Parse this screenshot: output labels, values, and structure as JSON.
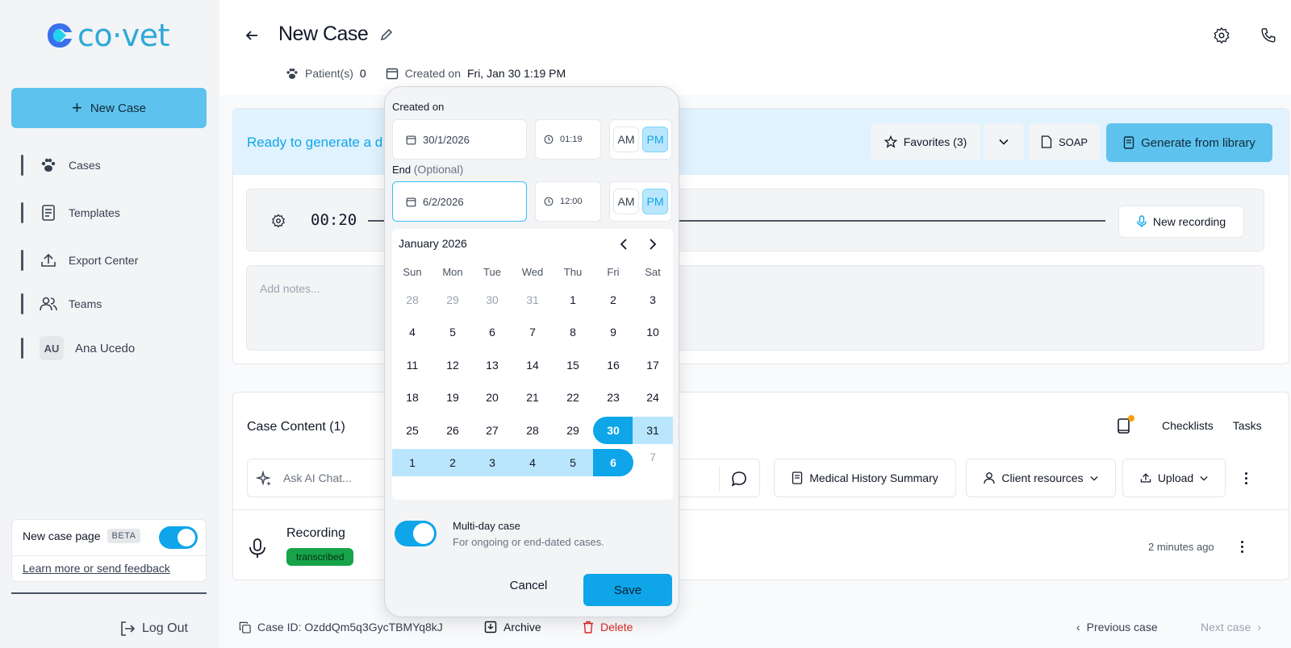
{
  "brand": {
    "name": "co·vet",
    "accent": "#2fa8d8"
  },
  "sidebar": {
    "new_case_label": "New Case",
    "items": [
      {
        "label": "Cases",
        "icon": "paw-icon"
      },
      {
        "label": "Templates",
        "icon": "document-icon"
      },
      {
        "label": "Export Center",
        "icon": "upload-icon"
      },
      {
        "label": "Teams",
        "icon": "users-icon"
      },
      {
        "label": "Ana Ucedo",
        "icon": "avatar",
        "initials": "AU"
      }
    ],
    "beta": {
      "label": "New case page",
      "badge": "BETA",
      "link": "Learn more or send feedback",
      "enabled": true
    },
    "logout_label": "Log Out"
  },
  "header": {
    "title": "New Case",
    "patients_label": "Patient(s)",
    "patients_count": "0",
    "created_label": "Created on",
    "created_value": "Fri, Jan 30 1:19 PM"
  },
  "banner": {
    "text": "Ready to generate a d",
    "favorites_label": "Favorites (3)",
    "soap_label": "SOAP",
    "generate_label": "Generate from library"
  },
  "recorder": {
    "timer": "00:20",
    "new_recording_label": "New recording",
    "notes_placeholder": "Add notes..."
  },
  "case_content": {
    "title": "Case Content (1)",
    "checklists_label": "Checklists",
    "tasks_label": "Tasks",
    "ask_placeholder": "Ask AI Chat...",
    "medical_history_label": "Medical History Summary",
    "client_resources_label": "Client resources",
    "upload_label": "Upload",
    "recording": {
      "title": "Recording",
      "status": "transcribed",
      "time": "2 minutes ago"
    }
  },
  "footer": {
    "case_id": "Case ID: OzddQm5q3GycTBMYq8kJ",
    "archive_label": "Archive",
    "delete_label": "Delete",
    "previous_label": "Previous case",
    "next_label": "Next case"
  },
  "picker": {
    "created_label": "Created on",
    "created_date": "30/1/2026",
    "created_time": "01:19",
    "end_label": "End",
    "end_optional": "(Optional)",
    "end_date": "6/2/2026",
    "end_time": "12:00",
    "am_label": "AM",
    "pm_label": "PM",
    "month_title": "January 2026",
    "weekdays": [
      "Sun",
      "Mon",
      "Tue",
      "Wed",
      "Thu",
      "Fri",
      "Sat"
    ],
    "weeks": [
      [
        "28",
        "29",
        "30",
        "31",
        "1",
        "2",
        "3"
      ],
      [
        "4",
        "5",
        "6",
        "7",
        "8",
        "9",
        "10"
      ],
      [
        "11",
        "12",
        "13",
        "14",
        "15",
        "16",
        "17"
      ],
      [
        "18",
        "19",
        "20",
        "21",
        "22",
        "23",
        "24"
      ],
      [
        "25",
        "26",
        "27",
        "28",
        "29",
        "30",
        "31"
      ],
      [
        "1",
        "2",
        "3",
        "4",
        "5",
        "6",
        "7"
      ]
    ],
    "multi_day_label": "Multi-day case",
    "multi_day_sub": "For ongoing or end-dated cases.",
    "multi_day_enabled": true,
    "cancel_label": "Cancel",
    "save_label": "Save"
  }
}
